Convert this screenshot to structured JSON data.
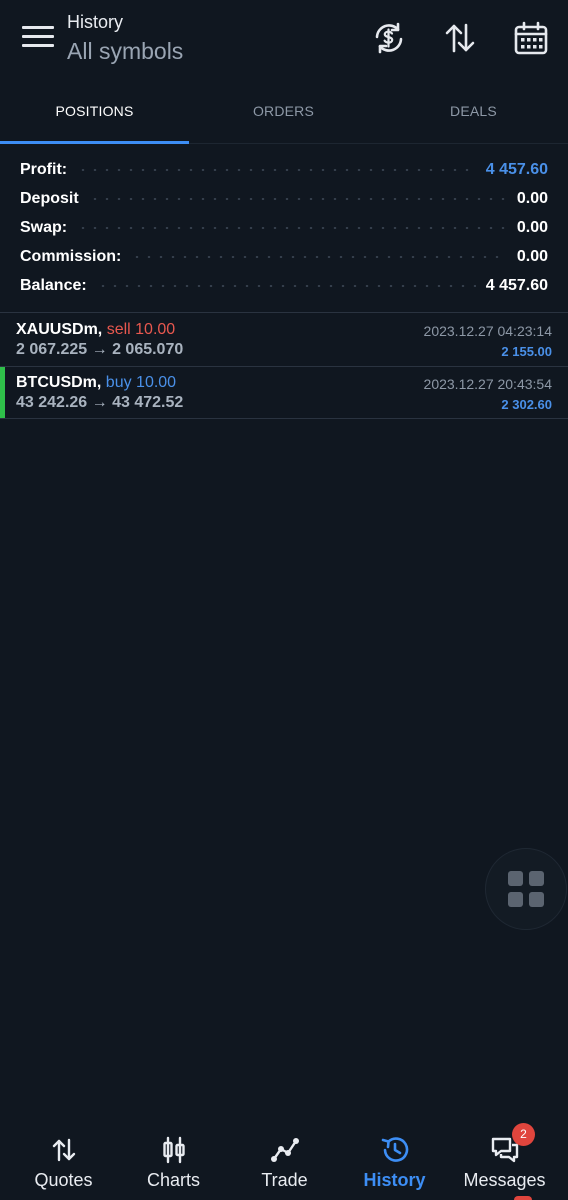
{
  "header": {
    "title": "History",
    "subtitle": "All symbols",
    "icons": [
      "menu-icon",
      "currency-exchange-icon",
      "sort-arrows-icon",
      "calendar-icon"
    ]
  },
  "tabs": [
    {
      "label": "POSITIONS",
      "active": true
    },
    {
      "label": "ORDERS",
      "active": false
    },
    {
      "label": "DEALS",
      "active": false
    }
  ],
  "summary": {
    "profit": {
      "label": "Profit:",
      "value": "4 457.60"
    },
    "deposit": {
      "label": "Deposit",
      "value": "0.00"
    },
    "swap": {
      "label": "Swap:",
      "value": "0.00"
    },
    "commission": {
      "label": "Commission:",
      "value": "0.00"
    },
    "balance": {
      "label": "Balance:",
      "value": "4 457.60"
    }
  },
  "deals": [
    {
      "symbol": "XAUUSDm,",
      "side": "sell 10.00",
      "prices": "2 067.225 → 2 065.070",
      "time": "2023.12.27 04:23:14",
      "profit": "2 155.00"
    },
    {
      "symbol": "BTCUSDm,",
      "side": "buy 10.00",
      "prices": "43 242.26 → 43 472.52",
      "time": "2023.12.27 20:43:54",
      "profit": "2 302.60"
    }
  ],
  "colors": {
    "background": "#101720",
    "accent": "#3d8ef5",
    "profit_blue": "#4a90e8",
    "sell_red": "#e8584f",
    "buy_indicator_green": "#2fbf4a"
  },
  "bottom_nav": {
    "quotes": "Quotes",
    "charts": "Charts",
    "trade": "Trade",
    "history": "History",
    "messages": "Messages",
    "messages_badge": "2",
    "active": "History"
  }
}
